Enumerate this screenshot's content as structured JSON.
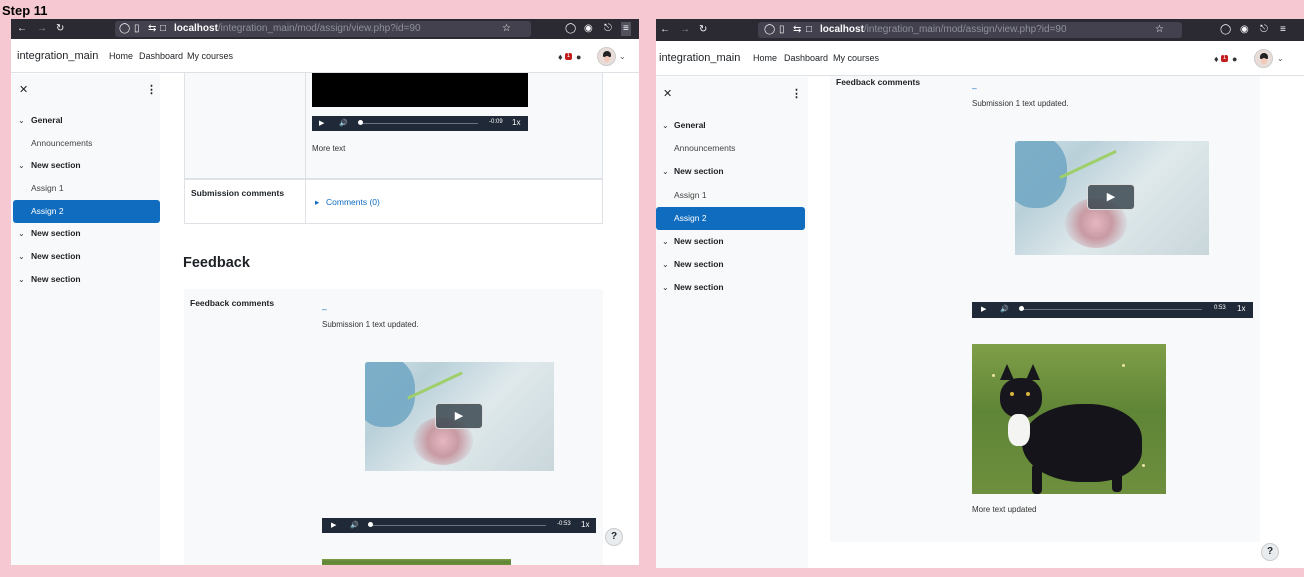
{
  "step_label": "Step 11",
  "browser": {
    "url_host": "localhost",
    "url_path": "/integration_main/mod/assign/view.php?id=90"
  },
  "navbar": {
    "site_name": "integration_main",
    "links": [
      "Home",
      "Dashboard",
      "My courses"
    ],
    "notification_count": "1"
  },
  "drawer": {
    "items": [
      {
        "label": "General",
        "type": "section"
      },
      {
        "label": "Announcements",
        "type": "activity"
      },
      {
        "label": "New section",
        "type": "section"
      },
      {
        "label": "Assign 1",
        "type": "activity"
      },
      {
        "label": "Assign 2",
        "type": "activity",
        "active": true
      },
      {
        "label": "New section",
        "type": "section"
      },
      {
        "label": "New section",
        "type": "section"
      },
      {
        "label": "New section",
        "type": "section"
      }
    ]
  },
  "left": {
    "audio_time": "-0:09",
    "speed": "1x",
    "more_text": "More text",
    "submission_comments_label": "Submission comments",
    "comments_link": "Comments (0)",
    "feedback_heading": "Feedback",
    "feedback_comments_label": "Feedback comments",
    "dash": "–",
    "submission_text": "Submission 1 text updated.",
    "audio_time_2": "-0:53",
    "speed_2": "1x"
  },
  "right": {
    "feedback_comments_label": "Feedback comments",
    "dash": "–",
    "submission_text": "Submission 1 text updated.",
    "audio_time": "0:53",
    "speed": "1x",
    "more_text": "More text updated"
  },
  "help_label": "?",
  "icons": [
    "back-icon",
    "forward-icon",
    "reload-icon",
    "shield-icon",
    "page-icon",
    "permissions-icon",
    "star-icon",
    "pocket-icon",
    "account-icon",
    "extensions-icon",
    "menu-icon",
    "bell-icon",
    "chat-icon",
    "chevron-down-icon",
    "play-icon",
    "volume-icon",
    "close-icon",
    "kebab-icon",
    "caret-right-icon"
  ]
}
